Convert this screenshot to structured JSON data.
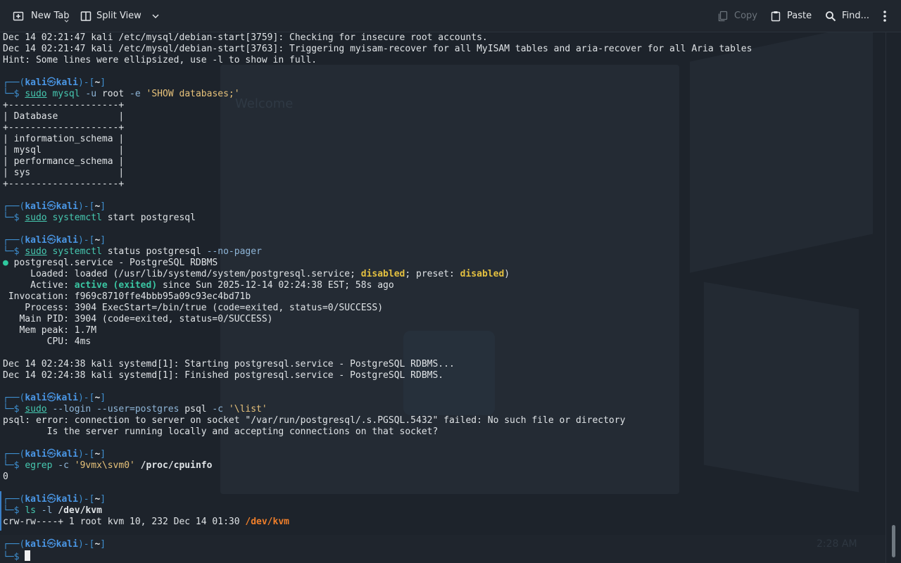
{
  "toolbar": {
    "new_tab": "New Tab",
    "split_view": "Split View",
    "copy": "Copy",
    "paste": "Paste",
    "find": "Find..."
  },
  "prompt": {
    "open": "┌──(",
    "user": "kali",
    "skull": "㉿",
    "host": "kali",
    "mid": ")-[",
    "dir": "~",
    "close": "]",
    "bottom": "└─$ "
  },
  "terminal": {
    "l1": "Dec 14 02:21:47 kali /etc/mysql/debian-start[3759]: Checking for insecure root accounts.",
    "l2": "Dec 14 02:21:47 kali /etc/mysql/debian-start[3763]: Triggering myisam-recover for all MyISAM tables and aria-recover for all Aria tables",
    "l3": "Hint: Some lines were ellipsized, use -l to show in full.",
    "cmd1": {
      "sudo": "sudo",
      "prog": "mysql",
      "a1": " -u",
      "a2": " root",
      "a3": " -e",
      "a4": " 'SHOW databases;'"
    },
    "table": [
      "+--------------------+",
      "| Database           |",
      "+--------------------+",
      "| information_schema |",
      "| mysql              |",
      "| performance_schema |",
      "| sys                |",
      "+--------------------+"
    ],
    "cmd2": {
      "sudo": "sudo",
      "prog": "systemctl",
      "rest": " start postgresql"
    },
    "cmd3": {
      "sudo": "sudo",
      "prog": "systemctl",
      "rest": " status postgresql",
      "opt": " --no-pager"
    },
    "status": {
      "dot": "●",
      "svc": " postgresql.service - PostgreSQL RDBMS",
      "loaded_label": "     Loaded: ",
      "loaded_pre": "loaded (/usr/lib/systemd/system/postgresql.service; ",
      "disabled1": "disabled",
      "loaded_mid": "; preset: ",
      "disabled2": "disabled",
      "loaded_post": ")",
      "active_label": "     Active: ",
      "active_val": "active (exited)",
      "active_rest": " since Sun 2025-12-14 02:24:38 EST; 58s ago",
      "invocation": " Invocation: f969c8710ffe4bbb95a09c93ec4bd71b",
      "process": "    Process: 3904 ExecStart=/bin/true (code=exited, status=0/SUCCESS)",
      "mainpid": "   Main PID: 3904 (code=exited, status=0/SUCCESS)",
      "mempeak": "   Mem peak: 1.7M",
      "cpu": "        CPU: 4ms"
    },
    "log1": "Dec 14 02:24:38 kali systemd[1]: Starting postgresql.service - PostgreSQL RDBMS...",
    "log2": "Dec 14 02:24:38 kali systemd[1]: Finished postgresql.service - PostgreSQL RDBMS.",
    "cmd4": {
      "sudo": "sudo",
      "opts": " --login --user=postgres",
      "prog": " psql",
      "opt": " -c",
      "str": " '\\list'"
    },
    "err1": "psql: error: connection to server on socket \"/var/run/postgresql/.s.PGSQL.5432\" failed: No such file or directory",
    "err2": "        Is the server running locally and accepting connections on that socket?",
    "cmd5": {
      "prog": "egrep",
      "opt": " -c",
      "str": " '9vmx\\svm0'",
      "path": " /proc/cpuinfo"
    },
    "out5": "0",
    "cmd6": {
      "prog": "ls",
      "opt": " -l",
      "path": " /dev/kvm"
    },
    "out6_pre": "crw-rw----+ 1 root kvm 10, 232 Dec 14 01:30 ",
    "out6_path": "/dev/kvm"
  },
  "background": {
    "welcome": "Welcome",
    "clock": "2:28 AM"
  }
}
